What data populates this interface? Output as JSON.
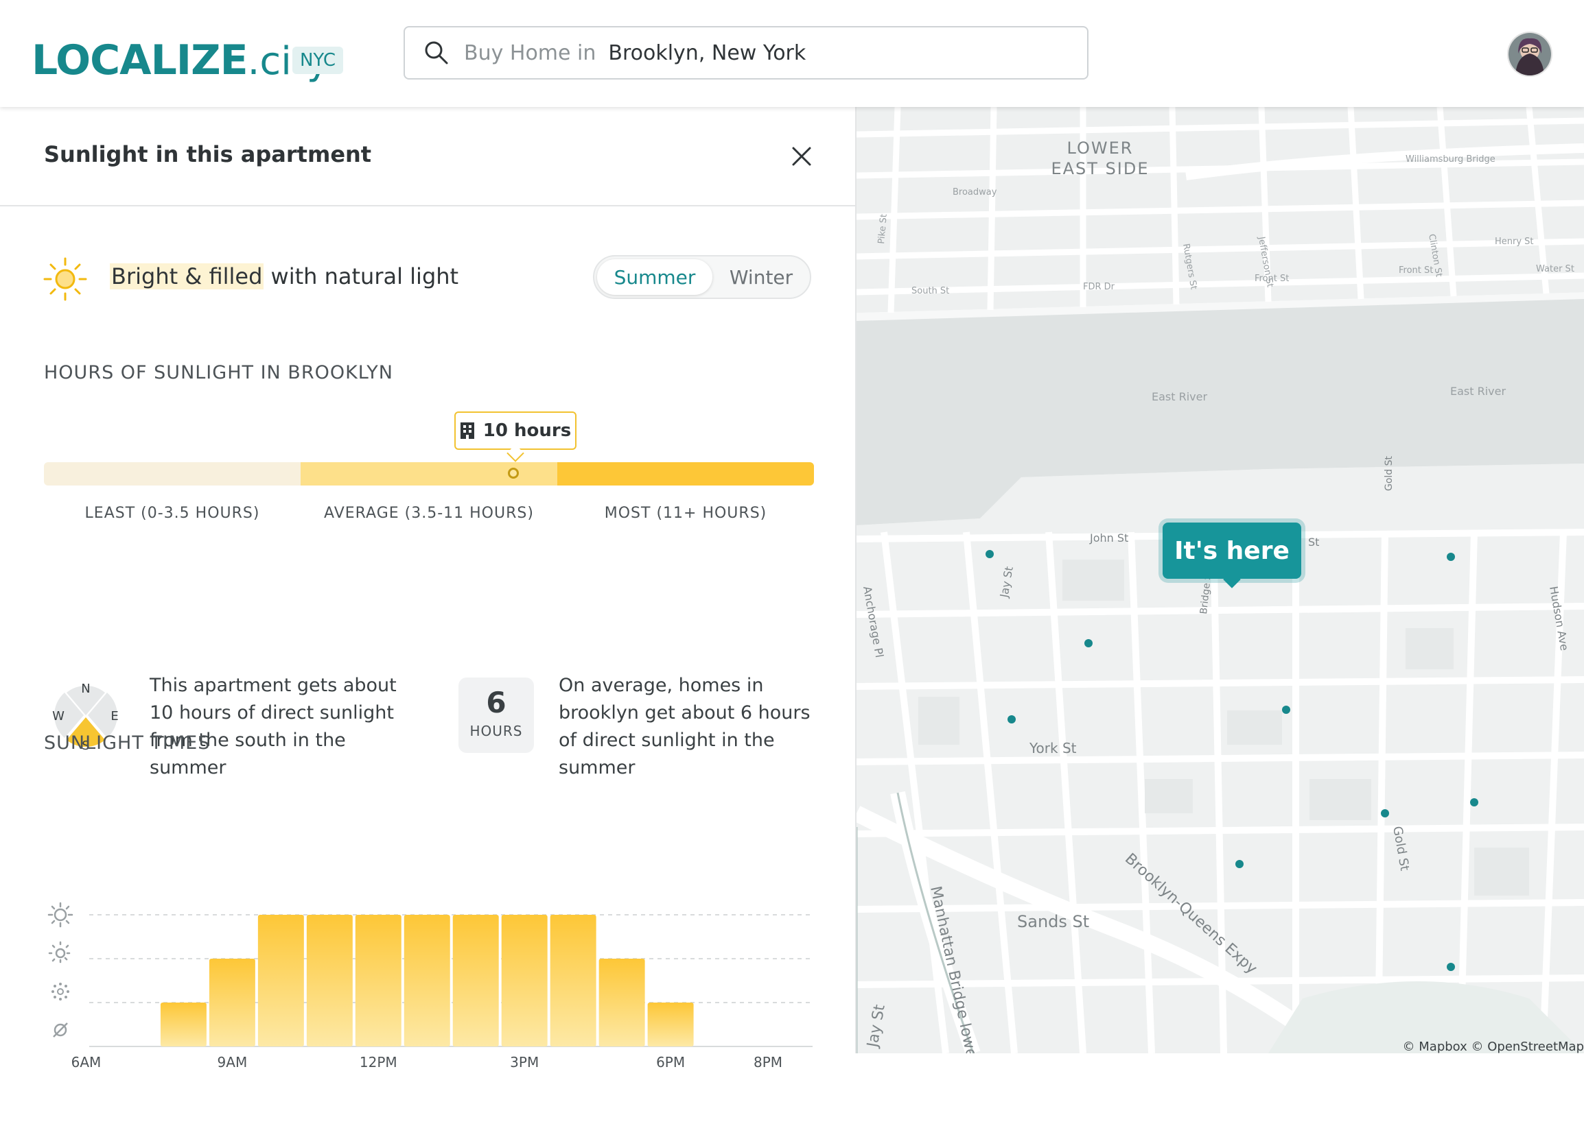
{
  "header": {
    "logo_main": "LOCALIZE",
    "logo_suffix": ".city",
    "city_badge": "NYC",
    "search_prefix": "Buy Home in",
    "search_value": "Brooklyn, New York"
  },
  "panel": {
    "title": "Sunlight in this apartment",
    "brightness_highlight": "Bright & filled",
    "brightness_rest": " with natural light",
    "season_toggle": {
      "options": [
        "Summer",
        "Winter"
      ],
      "selected": "Summer"
    },
    "hours_heading": "HOURS OF SUNLIGHT IN BROOKLYN",
    "hours_tooltip": "10 hours",
    "apartment_hours": 10,
    "scale_labels": [
      "LEAST (0-3.5 HOURS)",
      "AVERAGE (3.5-11 HOURS)",
      "MOST (11+ HOURS)"
    ],
    "compass": {
      "n": "N",
      "w": "W",
      "e": "E",
      "s": "S"
    },
    "apartment_desc": "This apartment gets about 10 hours of direct sunlight from the south in the summer",
    "avg_hours_num": "6",
    "avg_hours_unit": "HOURS",
    "avg_desc": "On average, homes in brooklyn get about 6 hours of direct sunlight in the summer",
    "times_heading": "SUNLIGHT TIMES"
  },
  "colors": {
    "accent": "#17888c",
    "sun": "#f7c531",
    "least": "#f8f0dd",
    "average": "#fde08a",
    "most": "#fdc737"
  },
  "chart_data": {
    "type": "bar",
    "x_tick_labels": [
      "6AM",
      "9AM",
      "12PM",
      "3PM",
      "6PM",
      "8PM"
    ],
    "y_levels": [
      "direct sun",
      "partial sun",
      "low sun",
      "no sun"
    ],
    "x": [
      8,
      9,
      10,
      11,
      12,
      13,
      14,
      15,
      16,
      17,
      18
    ],
    "values": [
      1,
      2,
      3,
      3,
      3,
      3,
      3,
      3,
      3,
      2,
      1
    ],
    "ylim": [
      0,
      3
    ],
    "xlim": [
      5.5,
      21
    ]
  },
  "map": {
    "pin_label": "It's here",
    "neighborhood": "LOWER\nEAST SIDE",
    "streets": [
      "East River",
      "East River",
      "John St",
      "Jay St",
      "York St",
      "Sands St",
      "Brooklyn-Queens Expy",
      "Manhattan Bridge lower",
      "Jay St",
      "Gold St",
      "Gold St",
      "Hudson Ave",
      "Anchorage Pl",
      "Bridge St",
      "South St",
      "FDR Dr",
      "Front St",
      "Front St",
      "Broadway",
      "Pike St",
      "Rutgers St",
      "Jefferson St",
      "Clinton St",
      "Henry St",
      "Water St",
      "Williamsburg Bridge",
      "St"
    ],
    "attribution": "© Mapbox © OpenStreetMap"
  }
}
